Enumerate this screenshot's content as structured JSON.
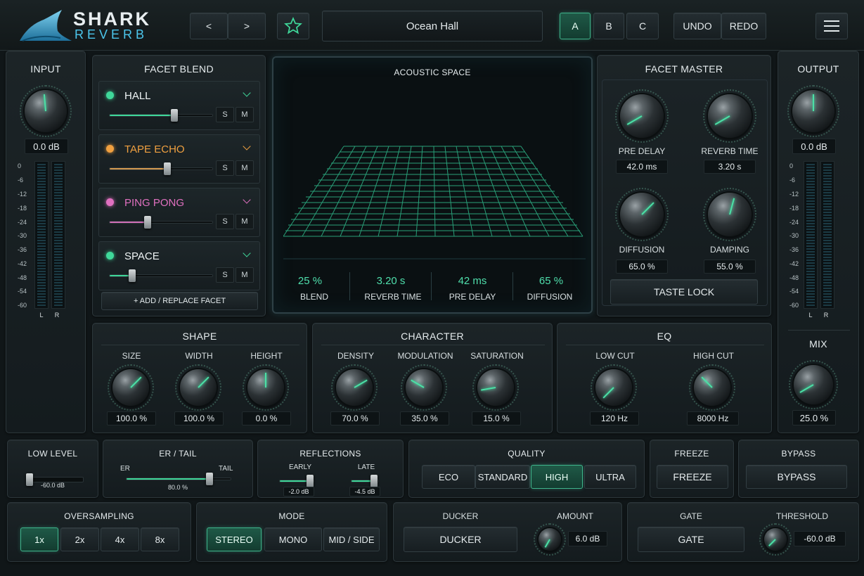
{
  "header": {
    "logo_line1": "SHARK",
    "logo_line2": "REVERB",
    "prev_label": "<",
    "next_label": ">",
    "preset_name": "Ocean Hall",
    "ab": [
      "A",
      "B",
      "C"
    ],
    "ab_active": "A",
    "undo": "UNDO",
    "redo": "REDO"
  },
  "input": {
    "title": "INPUT",
    "gain": "0.0 dB",
    "scale": [
      "0",
      "-6",
      "-12",
      "-18",
      "-24",
      "-30",
      "-36",
      "-42",
      "-48",
      "-54",
      "-60"
    ],
    "l": "L",
    "r": "R"
  },
  "output": {
    "title": "OUTPUT",
    "gain": "0.0 dB",
    "scale": [
      "0",
      "-6",
      "-12",
      "-18",
      "-24",
      "-30",
      "-36",
      "-42",
      "-48",
      "-54",
      "-60"
    ],
    "l": "L",
    "r": "R",
    "mix_title": "MIX",
    "mix": "25.0 %"
  },
  "facet_blend": {
    "title": "FACET BLEND",
    "facets": [
      {
        "name": "HALL",
        "color": "#3fd89a",
        "level": 0.63
      },
      {
        "name": "TAPE ECHO",
        "color": "#f0a040",
        "level": 0.56
      },
      {
        "name": "PING PONG",
        "color": "#e070c0",
        "level": 0.37
      },
      {
        "name": "SPACE",
        "color": "#3fd89a",
        "level": 0.22
      }
    ],
    "solo": "S",
    "mute": "M",
    "add_label": "+   ADD / REPLACE FACET"
  },
  "acoustic": {
    "title": "ACOUSTIC SPACE",
    "stats": [
      {
        "value": "25 %",
        "label": "BLEND"
      },
      {
        "value": "3.20 s",
        "label": "REVERB TIME"
      },
      {
        "value": "42 ms",
        "label": "PRE DELAY"
      },
      {
        "value": "65 %",
        "label": "DIFFUSION"
      }
    ]
  },
  "facet_master": {
    "title": "FACET MASTER",
    "knobs": [
      {
        "label": "PRE DELAY",
        "value": "42.0 ms"
      },
      {
        "label": "REVERB TIME",
        "value": "3.20 s"
      },
      {
        "label": "DIFFUSION",
        "value": "65.0 %"
      },
      {
        "label": "DAMPING",
        "value": "55.0 %"
      }
    ],
    "taste_lock": "TASTE LOCK"
  },
  "shape": {
    "title": "SHAPE",
    "knobs": [
      {
        "label": "SIZE",
        "value": "100.0 %"
      },
      {
        "label": "WIDTH",
        "value": "100.0 %"
      },
      {
        "label": "HEIGHT",
        "value": "0.0 %"
      }
    ]
  },
  "character": {
    "title": "CHARACTER",
    "knobs": [
      {
        "label": "DENSITY",
        "value": "70.0 %"
      },
      {
        "label": "MODULATION",
        "value": "35.0 %"
      },
      {
        "label": "SATURATION",
        "value": "15.0 %"
      }
    ]
  },
  "eq": {
    "title": "EQ",
    "knobs": [
      {
        "label": "LOW CUT",
        "value": "120 Hz"
      },
      {
        "label": "HIGH CUT",
        "value": "8000 Hz"
      }
    ]
  },
  "low_level": {
    "title": "LOW LEVEL",
    "value": "-60.0 dB"
  },
  "er_tail": {
    "title": "ER / TAIL",
    "er": "ER",
    "tail": "TAIL",
    "value": "80.0 %"
  },
  "reflections": {
    "title": "REFLECTIONS",
    "early": "EARLY",
    "late": "LATE",
    "early_value": "-2.0 dB",
    "late_value": "-4.5 dB"
  },
  "quality": {
    "title": "QUALITY",
    "options": [
      "ECO",
      "STANDARD",
      "HIGH",
      "ULTRA"
    ],
    "active": "HIGH"
  },
  "freeze": {
    "title": "FREEZE",
    "button": "FREEZE"
  },
  "bypass": {
    "title": "BYPASS",
    "button": "BYPASS"
  },
  "oversampling": {
    "title": "OVERSAMPLING",
    "options": [
      "1x",
      "2x",
      "4x",
      "8x"
    ],
    "active": "1x"
  },
  "mode": {
    "title": "MODE",
    "options": [
      "STEREO",
      "MONO",
      "MID / SIDE"
    ],
    "active": "STEREO"
  },
  "ducker": {
    "title": "DUCKER",
    "button": "DUCKER",
    "amount_title": "AMOUNT",
    "amount": "6.0 dB"
  },
  "gate": {
    "title": "GATE",
    "button": "GATE",
    "threshold_title": "THRESHOLD",
    "threshold": "-60.0 dB"
  }
}
